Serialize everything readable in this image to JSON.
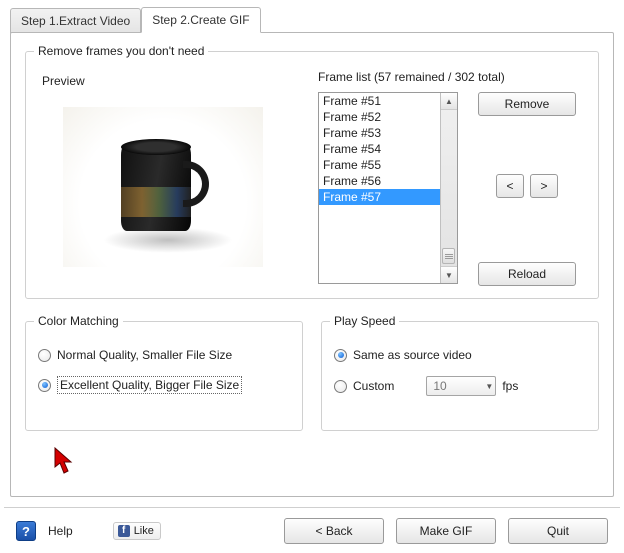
{
  "tabs": {
    "tab1": "Step 1.Extract Video",
    "tab2": "Step 2.Create GIF"
  },
  "frames_group": {
    "title": "Remove frames you don't need",
    "preview_label": "Preview",
    "list_label": "Frame list (57 remained / 302 total)",
    "items": [
      "Frame #51",
      "Frame #52",
      "Frame #53",
      "Frame #54",
      "Frame #55",
      "Frame #56",
      "Frame #57"
    ],
    "selected_index": 6,
    "remove_btn": "Remove",
    "prev_btn": "<",
    "next_btn": ">",
    "reload_btn": "Reload"
  },
  "color_group": {
    "title": "Color Matching",
    "opt_normal": "Normal Quality, Smaller File Size",
    "opt_excellent": "Excellent Quality, Bigger File Size",
    "selected": "excellent"
  },
  "play_group": {
    "title": "Play Speed",
    "opt_same": "Same as source video",
    "opt_custom": "Custom",
    "fps_value": "10",
    "fps_label": "fps",
    "selected": "same"
  },
  "footer": {
    "help": "Help",
    "like": "Like",
    "back": "< Back",
    "make": "Make GIF",
    "quit": "Quit"
  }
}
